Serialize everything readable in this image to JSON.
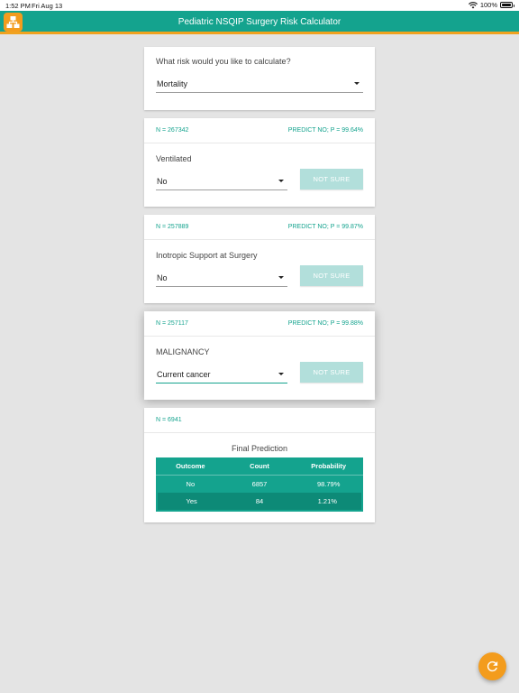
{
  "status_bar": {
    "time": "1:52 PM",
    "date": "Fri Aug 13",
    "battery": "100%"
  },
  "app_bar": {
    "title": "Pediatric NSQIP Surgery Risk Calculator"
  },
  "risk_selector": {
    "question": "What risk would you like to calculate?",
    "value": "Mortality"
  },
  "steps": [
    {
      "n": "N = 267342",
      "prediction": "PREDICT NO; P = 99.64%",
      "question": "Ventilated",
      "value": "No",
      "not_sure": "NOT SURE"
    },
    {
      "n": "N = 257889",
      "prediction": "PREDICT NO; P = 99.87%",
      "question": "Inotropic Support at Surgery",
      "value": "No",
      "not_sure": "NOT SURE"
    },
    {
      "n": "N = 257117",
      "prediction": "PREDICT NO; P = 99.88%",
      "question": "MALIGNANCY",
      "value": "Current cancer",
      "not_sure": "NOT SURE"
    }
  ],
  "final": {
    "n": "N = 6941",
    "title": "Final Prediction",
    "columns": [
      "Outcome",
      "Count",
      "Probability"
    ],
    "rows": [
      [
        "No",
        "6857",
        "98.79%"
      ],
      [
        "Yes",
        "84",
        "1.21%"
      ]
    ]
  },
  "colors": {
    "primary": "#14a38e",
    "accent": "#f39c1d",
    "not_sure_button": "#b2dfdb"
  },
  "icons": {
    "app_logo": "sitemap-icon",
    "fab": "refresh-icon",
    "wifi": "wifi-icon",
    "battery": "battery-icon"
  }
}
